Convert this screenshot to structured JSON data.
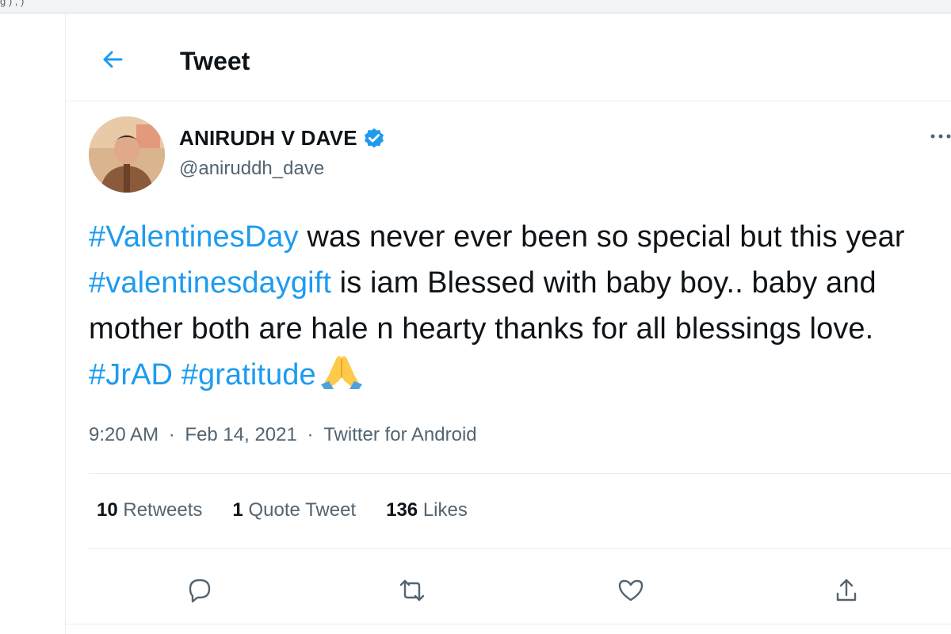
{
  "browser": {
    "crumb": "g ) ,  )"
  },
  "header": {
    "title": "Tweet",
    "back_icon": "arrow-left-icon"
  },
  "author": {
    "name": "ANIRUDH V DAVE",
    "handle": "@aniruddh_dave",
    "verified": true,
    "verified_icon": "verified-badge-icon",
    "more_icon": "more-horizontal-icon"
  },
  "tweet": {
    "segments": [
      {
        "text": "#ValentinesDay",
        "hashtag": true
      },
      {
        "text": " was never ever been so special but this year  ",
        "hashtag": false
      },
      {
        "text": "#valentinesdaygift",
        "hashtag": true
      },
      {
        "text": " is iam Blessed with baby boy.. baby and mother both are hale n hearty thanks for all blessings love. ",
        "hashtag": false
      },
      {
        "text": "#JrAD",
        "hashtag": true
      },
      {
        "text": " ",
        "hashtag": false
      },
      {
        "text": "#gratitude",
        "hashtag": true
      }
    ],
    "emoji_icon": "folded-hands-icon",
    "time": "9:20 AM",
    "separator": "·",
    "date": "Feb 14, 2021",
    "source": "Twitter for Android"
  },
  "stats": {
    "retweets_count": "10",
    "retweets_label": "Retweets",
    "quotes_count": "1",
    "quotes_label": "Quote Tweet",
    "likes_count": "136",
    "likes_label": "Likes"
  },
  "actions": {
    "reply_icon": "reply-icon",
    "retweet_icon": "retweet-icon",
    "like_icon": "heart-icon",
    "share_icon": "share-icon"
  },
  "colors": {
    "accent": "#1d9bf0",
    "text_primary": "#0f1419",
    "text_secondary": "#536471",
    "divider": "#ebeef0"
  }
}
